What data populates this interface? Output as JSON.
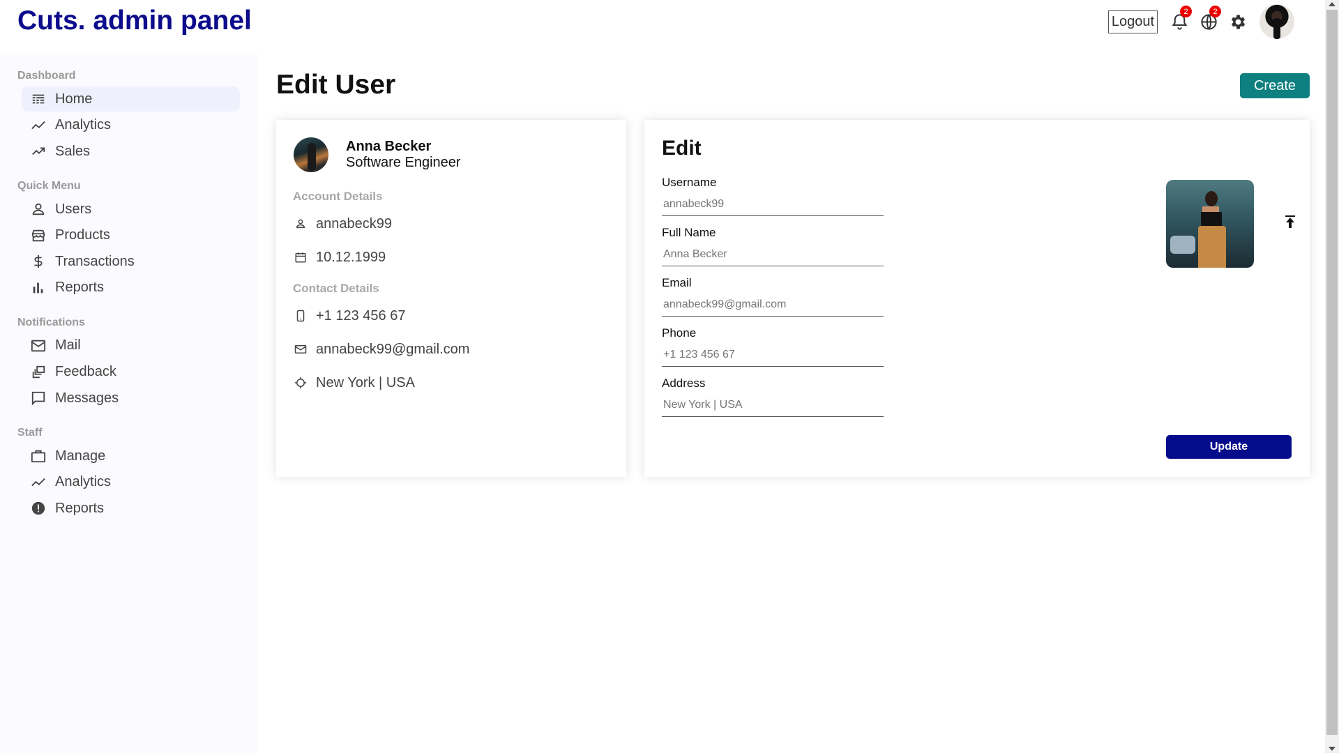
{
  "app": {
    "title": "Cuts. admin panel"
  },
  "topbar": {
    "logout_label": "Logout",
    "notifications_badge": "2",
    "language_badge": "2",
    "icons": [
      "bell-icon",
      "globe-icon",
      "gear-icon"
    ]
  },
  "sidebar": {
    "sections": [
      {
        "title": "Dashboard",
        "items": [
          {
            "label": "Home",
            "icon": "home-icon",
            "active": true
          },
          {
            "label": "Analytics",
            "icon": "timeline-icon"
          },
          {
            "label": "Sales",
            "icon": "trending-up-icon"
          }
        ]
      },
      {
        "title": "Quick Menu",
        "items": [
          {
            "label": "Users",
            "icon": "user-icon"
          },
          {
            "label": "Products",
            "icon": "store-icon"
          },
          {
            "label": "Transactions",
            "icon": "dollar-icon"
          },
          {
            "label": "Reports",
            "icon": "bar-chart-icon"
          }
        ]
      },
      {
        "title": "Notifications",
        "items": [
          {
            "label": "Mail",
            "icon": "mail-icon"
          },
          {
            "label": "Feedback",
            "icon": "dynamic-feed-icon"
          },
          {
            "label": "Messages",
            "icon": "chat-bubble-icon"
          }
        ]
      },
      {
        "title": "Staff",
        "items": [
          {
            "label": "Manage",
            "icon": "work-icon"
          },
          {
            "label": "Analytics",
            "icon": "timeline-icon"
          },
          {
            "label": "Reports",
            "icon": "report-icon"
          }
        ]
      }
    ]
  },
  "page": {
    "title": "Edit User",
    "create_label": "Create"
  },
  "user_show": {
    "name": "Anna Becker",
    "job": "Software Engineer",
    "account_label": "Account Details",
    "username": "annabeck99",
    "birthday": "10.12.1999",
    "contact_label": "Contact Details",
    "phone": "+1 123 456 67",
    "email": "annabeck99@gmail.com",
    "address": "New York | USA"
  },
  "edit_form": {
    "title": "Edit",
    "fields": [
      {
        "label": "Username",
        "placeholder": "annabeck99"
      },
      {
        "label": "Full Name",
        "placeholder": "Anna Becker"
      },
      {
        "label": "Email",
        "placeholder": "annabeck99@gmail.com"
      },
      {
        "label": "Phone",
        "placeholder": "+1 123 456 67"
      },
      {
        "label": "Address",
        "placeholder": "New York | USA"
      }
    ],
    "update_label": "Update"
  },
  "colors": {
    "brand": "#0c0c8c",
    "create_button": "#0e8080",
    "update_button": "#050c8c",
    "badge": "#ee0000",
    "sidebar_bg": "#fbfbff",
    "active_item_bg": "#eef0fb"
  }
}
